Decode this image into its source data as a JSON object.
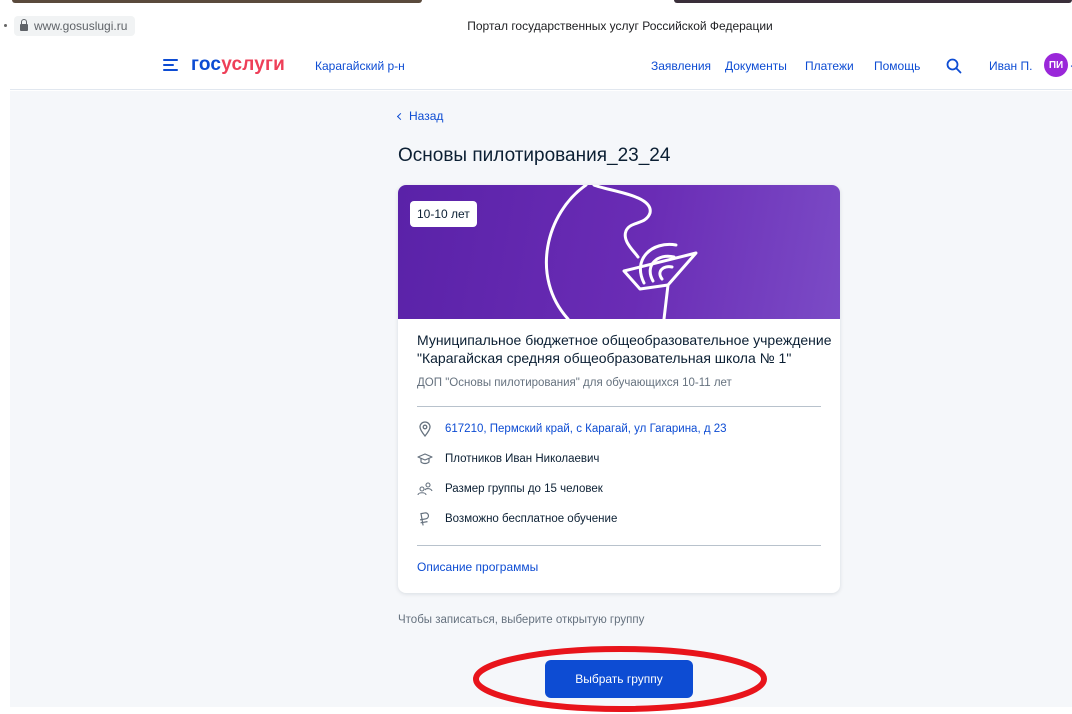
{
  "browser": {
    "url": "www.gosuslugi.ru",
    "window_title": "Портал государственных услуг Российской Федерации"
  },
  "header": {
    "logo_part1": "гос",
    "logo_part2": "услуги",
    "region": "Карагайский р-н",
    "nav": [
      "Заявления",
      "Документы",
      "Платежи",
      "Помощь"
    ],
    "user_name": "Иван П.",
    "avatar_initials": "ПИ"
  },
  "main": {
    "back_label": "Назад",
    "title": "Основы пилотирования_23_24",
    "card": {
      "age_badge": "10-10 лет",
      "org_name": "Муниципальное бюджетное общеобразовательное учреждение \"Карагайская средняя общеобразовательная школа № 1\"",
      "program_desc": "ДОП \"Основы пилотирования\" для обучающихся 10-11 лет",
      "address": "617210, Пермский край, с Карагай, ул Гагарина, д 23",
      "teacher": "Плотников Иван Николаевич",
      "group_size": "Размер группы до 15 человек",
      "payment": "Возможно бесплатное обучение",
      "program_link": "Описание программы"
    },
    "hint": "Чтобы записаться, выберите открытую группу",
    "choose_button": "Выбрать группу"
  },
  "colors": {
    "accent": "#0d4cd3",
    "brand_red": "#ee3f58",
    "banner": "#6a2cb5",
    "avatar": "#9a27d9",
    "highlight_ellipse": "#e8141b"
  },
  "icons": [
    "lock-icon",
    "menu-icon",
    "search-icon",
    "chevron-down-icon",
    "chevron-left-icon",
    "location-pin-icon",
    "graduation-cap-icon",
    "group-icon",
    "ruble-icon"
  ]
}
